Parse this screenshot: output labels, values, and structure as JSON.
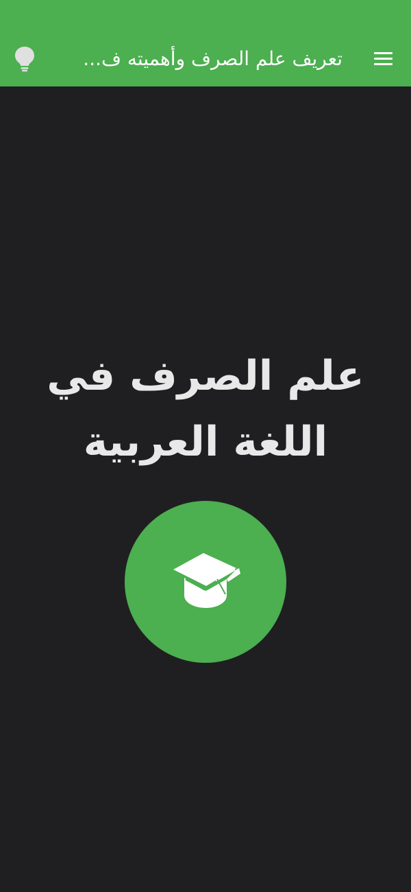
{
  "header": {
    "title": "تعريف علم الصرف وأهميته ف...",
    "menu_icon": "hamburger-menu-icon",
    "bulb_icon": "lightbulb-icon"
  },
  "main": {
    "heading": "علم الصرف في اللغة العربية",
    "center_icon": "graduation-cap-icon"
  },
  "colors": {
    "accent": "#4caf50",
    "background": "#1f1f22",
    "heading_text": "#e8e8e8",
    "icon": "#ffffff",
    "bulb": "#e0e0e0"
  }
}
